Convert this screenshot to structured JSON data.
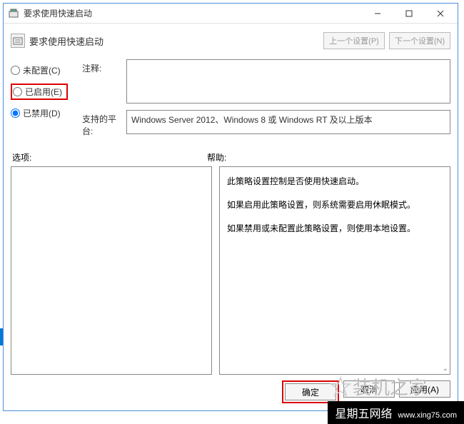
{
  "window": {
    "title": "要求使用快速启动",
    "header_title": "要求使用快速启动",
    "prev_btn": "上一个设置(P)",
    "next_btn": "下一个设置(N)"
  },
  "radios": {
    "not_configured": "未配置(C)",
    "enabled": "已启用(E)",
    "disabled": "已禁用(D)"
  },
  "fields": {
    "comment_label": "注释:",
    "comment_value": "",
    "platform_label": "支持的平台:",
    "platform_value": "Windows Server 2012、Windows 8 或 Windows RT 及以上版本"
  },
  "lower": {
    "options_label": "选项:",
    "help_label": "帮助:",
    "help_p1": "此策略设置控制是否使用快速启动。",
    "help_p2": "如果启用此策略设置，则系统需要启用休眠模式。",
    "help_p3": "如果禁用或未配置此策略设置，则使用本地设置。"
  },
  "footer": {
    "ok": "确定",
    "cancel": "取消",
    "apply": "应用(A)"
  },
  "branding": {
    "watermark": "装机之家",
    "bottom_name": "星期五网络",
    "bottom_url": "www.xing75.com"
  }
}
